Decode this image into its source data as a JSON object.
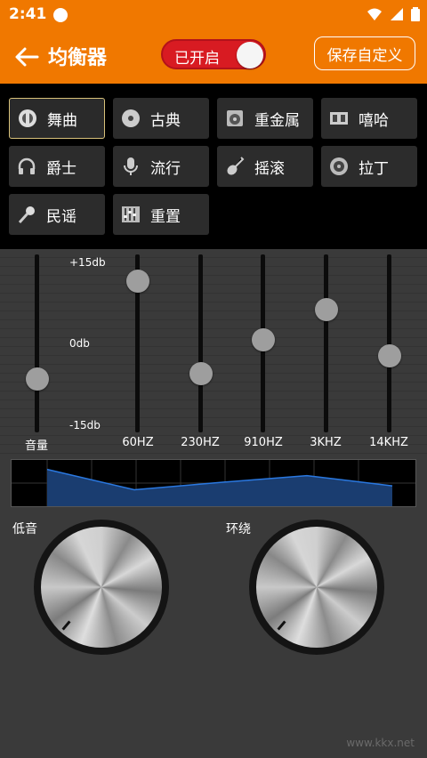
{
  "status": {
    "time": "2:41"
  },
  "toolbar": {
    "title": "均衡器",
    "toggle_label": "已开启",
    "save_label": "保存自定义"
  },
  "presets": [
    {
      "label": "舞曲",
      "icon": "dance-icon",
      "selected": true
    },
    {
      "label": "古典",
      "icon": "cd-icon"
    },
    {
      "label": "重金属",
      "icon": "speaker-icon"
    },
    {
      "label": "嘻哈",
      "icon": "film-icon"
    },
    {
      "label": "爵士",
      "icon": "headphones-icon"
    },
    {
      "label": "流行",
      "icon": "microphone-icon"
    },
    {
      "label": "摇滚",
      "icon": "guitar-icon"
    },
    {
      "label": "拉丁",
      "icon": "disc-icon"
    },
    {
      "label": "民谣",
      "icon": "handheld-mic-icon"
    },
    {
      "label": "重置",
      "icon": "mixer-icon"
    }
  ],
  "eq": {
    "db_top": "+15db",
    "db_mid": "0db",
    "db_bottom": "-15db",
    "volume_label": "音量",
    "bands": [
      {
        "label": "60HZ",
        "level": 0.85
      },
      {
        "label": "230HZ",
        "level": 0.33
      },
      {
        "label": "910HZ",
        "level": 0.52
      },
      {
        "label": "3KHZ",
        "level": 0.69
      },
      {
        "label": "14KHZ",
        "level": 0.43
      }
    ],
    "volume_level": 0.3
  },
  "knobs": {
    "bass_label": "低音",
    "surround_label": "环绕"
  },
  "watermark": "www.kkx.net",
  "colors": {
    "accent": "#f07800",
    "toggle": "#d81b22",
    "curve": "#1e64c8"
  }
}
